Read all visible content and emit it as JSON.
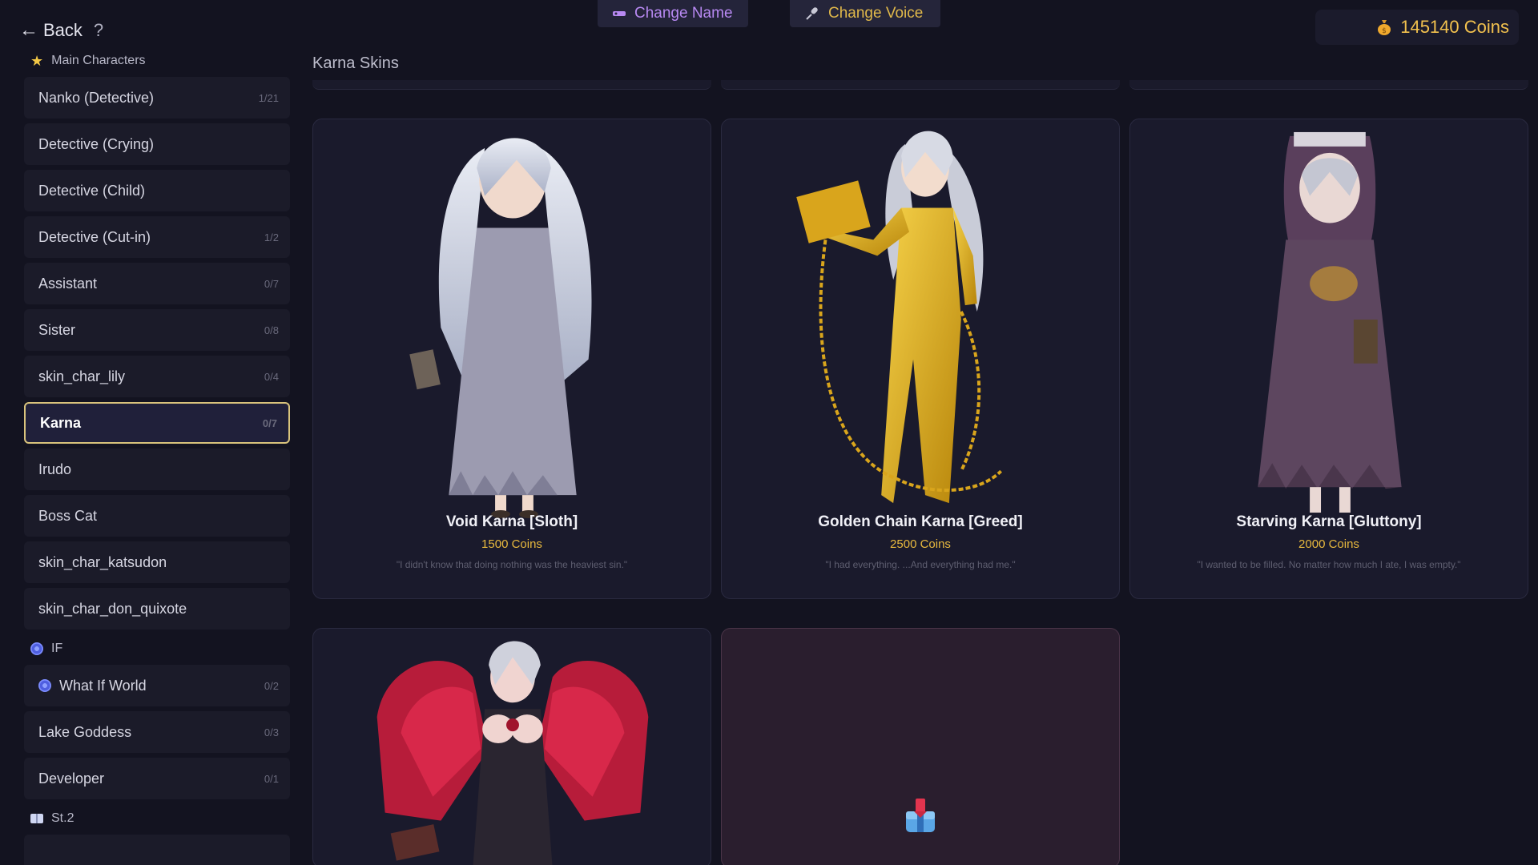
{
  "nav": {
    "back_label": "Back",
    "help": "?"
  },
  "top_buttons": {
    "change_name": "Change Name",
    "change_voice": "Change Voice"
  },
  "coins": {
    "label": "145140 Coins"
  },
  "sidebar": {
    "groups": [
      {
        "title": "Main Characters",
        "icon": "star-icon",
        "items": [
          {
            "label": "Nanko (Detective)",
            "count": "1/21"
          },
          {
            "label": "Detective (Crying)",
            "count": ""
          },
          {
            "label": "Detective (Child)",
            "count": ""
          },
          {
            "label": "Detective (Cut-in)",
            "count": "1/2"
          },
          {
            "label": "Assistant",
            "count": "0/7"
          },
          {
            "label": "Sister",
            "count": "0/8"
          },
          {
            "label": "skin_char_lily",
            "count": "0/4"
          },
          {
            "label": "Karna",
            "count": "0/7",
            "active": true
          },
          {
            "label": "Irudo",
            "count": ""
          },
          {
            "label": "Boss Cat",
            "count": ""
          },
          {
            "label": "skin_char_katsudon",
            "count": ""
          },
          {
            "label": "skin_char_don_quixote",
            "count": ""
          }
        ]
      },
      {
        "title": "IF",
        "icon": "swirl-icon",
        "items": [
          {
            "label": "What If World",
            "count": "0/2",
            "icon": "swirl-icon"
          },
          {
            "label": "Lake Goddess",
            "count": "0/3"
          },
          {
            "label": "Developer",
            "count": "0/1"
          }
        ]
      },
      {
        "title": "St.2",
        "icon": "book-icon",
        "items": []
      }
    ]
  },
  "main": {
    "section_title": "Karna Skins",
    "skins": [
      {
        "name": "Void Karna [Sloth]",
        "price": "1500 Coins",
        "quote": "\"I didn't know that doing nothing was the heaviest sin.\""
      },
      {
        "name": "Golden Chain Karna [Greed]",
        "price": "2500 Coins",
        "quote": "\"I had everything. ...And everything had me.\""
      },
      {
        "name": "Starving Karna [Gluttony]",
        "price": "2000 Coins",
        "quote": "\"I wanted to be filled. No matter how much I ate, I was empty.\""
      },
      {
        "name": "",
        "price": "",
        "quote": ""
      }
    ]
  },
  "colors": {
    "background": "#131320",
    "accent_gold": "#e8b93e",
    "active_border": "#d9c37c",
    "name_button_text": "#b889f2",
    "voice_button_text": "#e0b84a"
  }
}
